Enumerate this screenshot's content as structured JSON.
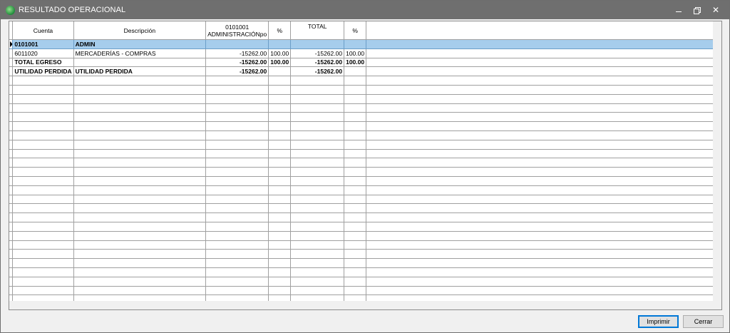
{
  "window": {
    "title": "RESULTADO OPERACIONAL",
    "minimize_glyph": "",
    "close_glyph": "✕"
  },
  "grid": {
    "headers": {
      "cuenta": "Cuenta",
      "descripcion": "Descripción",
      "admin_line1": "0101001",
      "admin_line2": "ADMINISTRACIÓNpo",
      "pct1": "%",
      "total": "TOTAL",
      "pct2": "%"
    },
    "rows": [
      {
        "cuenta": "0101001",
        "descripcion": "ADMIN",
        "admin": "",
        "pct1": "",
        "total": "",
        "pct2": ""
      },
      {
        "cuenta": "6011020",
        "descripcion": "MERCADERÍAS - COMPRAS",
        "admin": "-15262.00",
        "pct1": "100.00",
        "total": "-15262.00",
        "pct2": "100.00"
      },
      {
        "cuenta": "TOTAL EGRESO",
        "descripcion": "",
        "admin": "-15262.00",
        "pct1": "100.00",
        "total": "-15262.00",
        "pct2": "100.00"
      },
      {
        "cuenta": "UTILIDAD PERDIDA",
        "descripcion": "UTILIDAD PERDIDA",
        "admin": "-15262.00",
        "pct1": "",
        "total": "-15262.00",
        "pct2": ""
      }
    ]
  },
  "buttons": {
    "print": "Imprimir",
    "close": "Cerrar"
  },
  "colors": {
    "titlebar": "#6f6f6f",
    "selected_row": "#a6cdec"
  }
}
